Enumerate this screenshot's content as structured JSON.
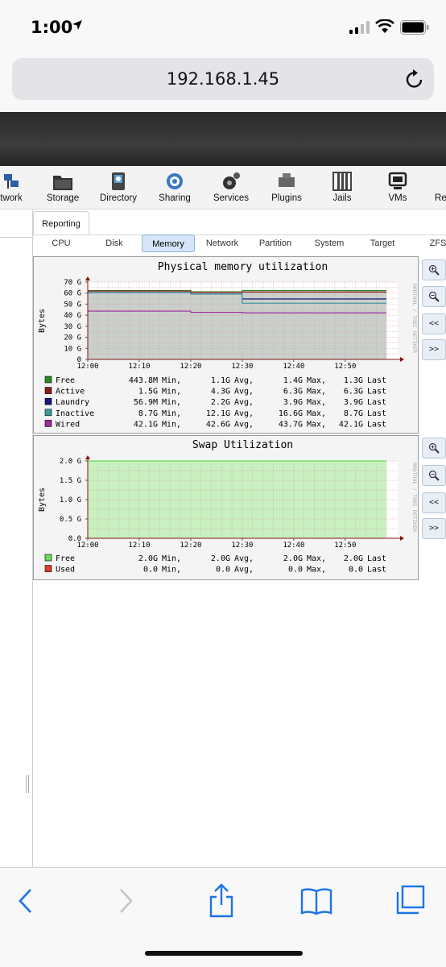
{
  "status_bar": {
    "time": "1:00"
  },
  "browser": {
    "url": "192.168.1.45"
  },
  "toolbar": {
    "items": [
      {
        "label": "twork",
        "icon": "network-icon"
      },
      {
        "label": "Storage",
        "icon": "storage-icon"
      },
      {
        "label": "Directory",
        "icon": "directory-icon"
      },
      {
        "label": "Sharing",
        "icon": "sharing-icon"
      },
      {
        "label": "Services",
        "icon": "services-icon"
      },
      {
        "label": "Plugins",
        "icon": "plugins-icon"
      },
      {
        "label": "Jails",
        "icon": "jails-icon"
      },
      {
        "label": "VMs",
        "icon": "vms-icon"
      },
      {
        "label": "Re",
        "icon": "reporting-icon"
      }
    ]
  },
  "reporting": {
    "tab_label": "Reporting",
    "subtabs": [
      "CPU",
      "Disk",
      "Memory",
      "Network",
      "Partition",
      "System",
      "Target",
      "ZFS"
    ],
    "active_subtab": "Memory"
  },
  "graph_buttons": {
    "zoom_in": "zoom-in-icon",
    "zoom_out": "zoom-out-icon",
    "back": "<<",
    "forward": ">>"
  },
  "rrd_watermark": "RRDTOOL / TOBI OETIKER",
  "chart_data": [
    {
      "type": "area",
      "title": "Physical memory utilization",
      "ylabel": "Bytes",
      "yticks": [
        "70 G",
        "60 G",
        "50 G",
        "40 G",
        "30 G",
        "20 G",
        "10 G",
        "0"
      ],
      "ylim": [
        0,
        70
      ],
      "xticks": [
        "12:00",
        "12:10",
        "12:20",
        "12:30",
        "12:40",
        "12:50"
      ],
      "x": [
        "12:00",
        "12:10",
        "12:20",
        "12:30",
        "12:40",
        "12:50",
        "12:58"
      ],
      "series": [
        {
          "name": "Free",
          "color": "#2a8a22",
          "values": [
            0.44,
            0.44,
            0.44,
            1.4,
            1.4,
            1.3,
            1.3
          ],
          "min": "443.8M",
          "avg": "1.1G",
          "max": "1.4G",
          "last": "1.3G"
        },
        {
          "name": "Active",
          "color": "#8a1a1a",
          "values": [
            1.5,
            1.5,
            1.5,
            6.3,
            6.3,
            6.3,
            6.3
          ],
          "min": "1.5G",
          "avg": "4.3G",
          "max": "6.3G",
          "last": "6.3G"
        },
        {
          "name": "Laundry",
          "color": "#16167f",
          "values": [
            0.06,
            0.06,
            0.06,
            3.9,
            3.9,
            3.9,
            3.9
          ],
          "min": "56.9M",
          "avg": "2.2G",
          "max": "3.9G",
          "last": "3.9G"
        },
        {
          "name": "Inactive",
          "color": "#3c9b9b",
          "values": [
            16.6,
            16.6,
            16.6,
            8.7,
            8.7,
            8.7,
            8.7
          ],
          "min": "8.7G",
          "avg": "12.1G",
          "max": "16.6G",
          "last": "8.7G"
        },
        {
          "name": "Wired",
          "color": "#9b2a9b",
          "values": [
            43.7,
            43.7,
            42.6,
            42.1,
            42.1,
            42.1,
            42.1
          ],
          "min": "42.1G",
          "avg": "42.6G",
          "max": "43.7G",
          "last": "42.1G"
        }
      ],
      "labels": {
        "min": "Min,",
        "avg": "Avg,",
        "max": "Max,",
        "last": "Last"
      }
    },
    {
      "type": "area",
      "title": "Swap Utilization",
      "ylabel": "Bytes",
      "yticks": [
        "2.0 G",
        "1.5 G",
        "1.0 G",
        "0.5 G",
        "0.0"
      ],
      "ylim": [
        0,
        2.0
      ],
      "xticks": [
        "12:00",
        "12:10",
        "12:20",
        "12:30",
        "12:40",
        "12:50"
      ],
      "x": [
        "12:00",
        "12:58"
      ],
      "series": [
        {
          "name": "Free",
          "color": "#66dd55",
          "values": [
            2.0,
            2.0
          ],
          "min": "2.0G",
          "avg": "2.0G",
          "max": "2.0G",
          "last": "2.0G"
        },
        {
          "name": "Used",
          "color": "#e03a2a",
          "values": [
            0,
            0
          ],
          "min": "0.0",
          "avg": "0.0",
          "max": "0.0",
          "last": "0.0"
        }
      ],
      "labels": {
        "min": "Min,",
        "avg": "Avg,",
        "max": "Max,",
        "last": "Last"
      }
    }
  ]
}
